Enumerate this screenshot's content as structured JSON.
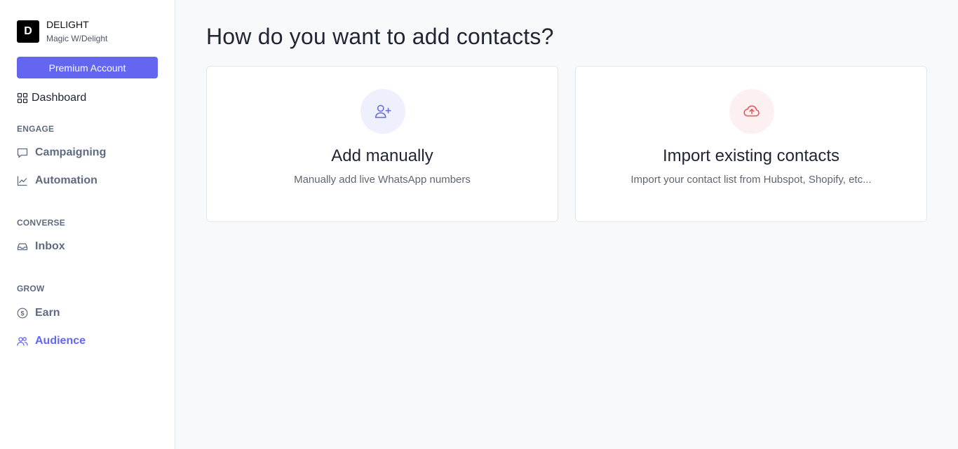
{
  "brand": {
    "logo_letter": "D",
    "name": "DELIGHT",
    "subtitle": "Magic W/Delight"
  },
  "sidebar": {
    "premium_label": "Premium Account",
    "dashboard_label": "Dashboard",
    "sections": {
      "engage": "ENGAGE",
      "converse": "CONVERSE",
      "grow": "GROW"
    },
    "items": {
      "campaigning": "Campaigning",
      "automation": "Automation",
      "inbox": "Inbox",
      "earn": "Earn",
      "audience": "Audience"
    },
    "active_item": "audience"
  },
  "main": {
    "title": "How do you want to add contacts?",
    "cards": [
      {
        "title": "Add manually",
        "description": "Manually add live WhatsApp numbers",
        "icon": "user-plus-icon"
      },
      {
        "title": "Import existing contacts",
        "description": "Import your contact list from Hubspot, Shopify, etc...",
        "icon": "cloud-upload-icon"
      }
    ]
  },
  "colors": {
    "accent": "#6366f1",
    "import_icon": "#e8505b",
    "muted": "#5f6b80"
  }
}
